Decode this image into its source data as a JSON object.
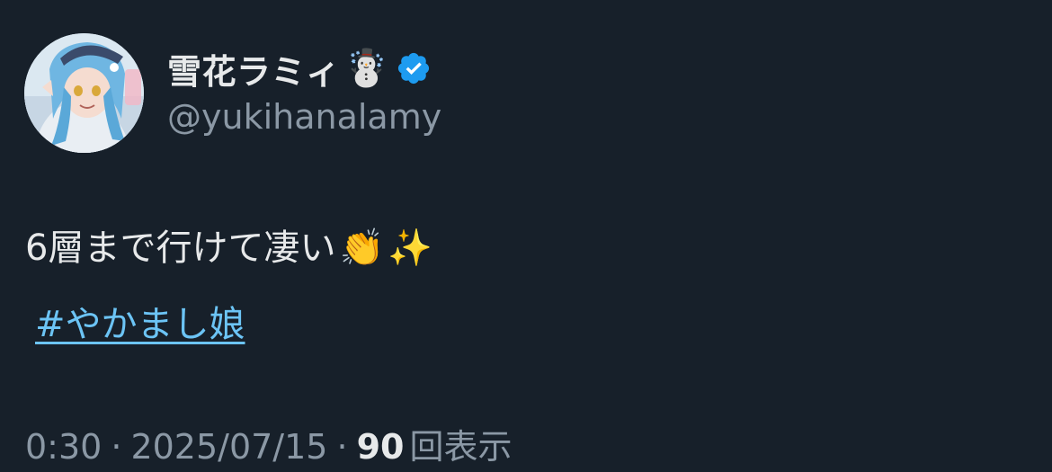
{
  "author": {
    "display_name": "雪花ラミィ",
    "name_emoji": "☃️",
    "verified": true,
    "handle": "@yukihanalamy",
    "avatar_icon": "avatar-image-icon"
  },
  "tweet": {
    "text": "6層まで行けて凄い",
    "emoji_1": "👏",
    "emoji_2": "✨",
    "hashtag": "#やかまし娘"
  },
  "meta": {
    "time": "0:30",
    "separator": "·",
    "date": "2025/07/15",
    "views_count": "90",
    "views_label": "回表示"
  },
  "colors": {
    "background": "#17202a",
    "text_primary": "#e7e9ea",
    "text_secondary": "#8b98a5",
    "link": "#6cc4f5",
    "verified_badge": "#1d9bf0"
  }
}
